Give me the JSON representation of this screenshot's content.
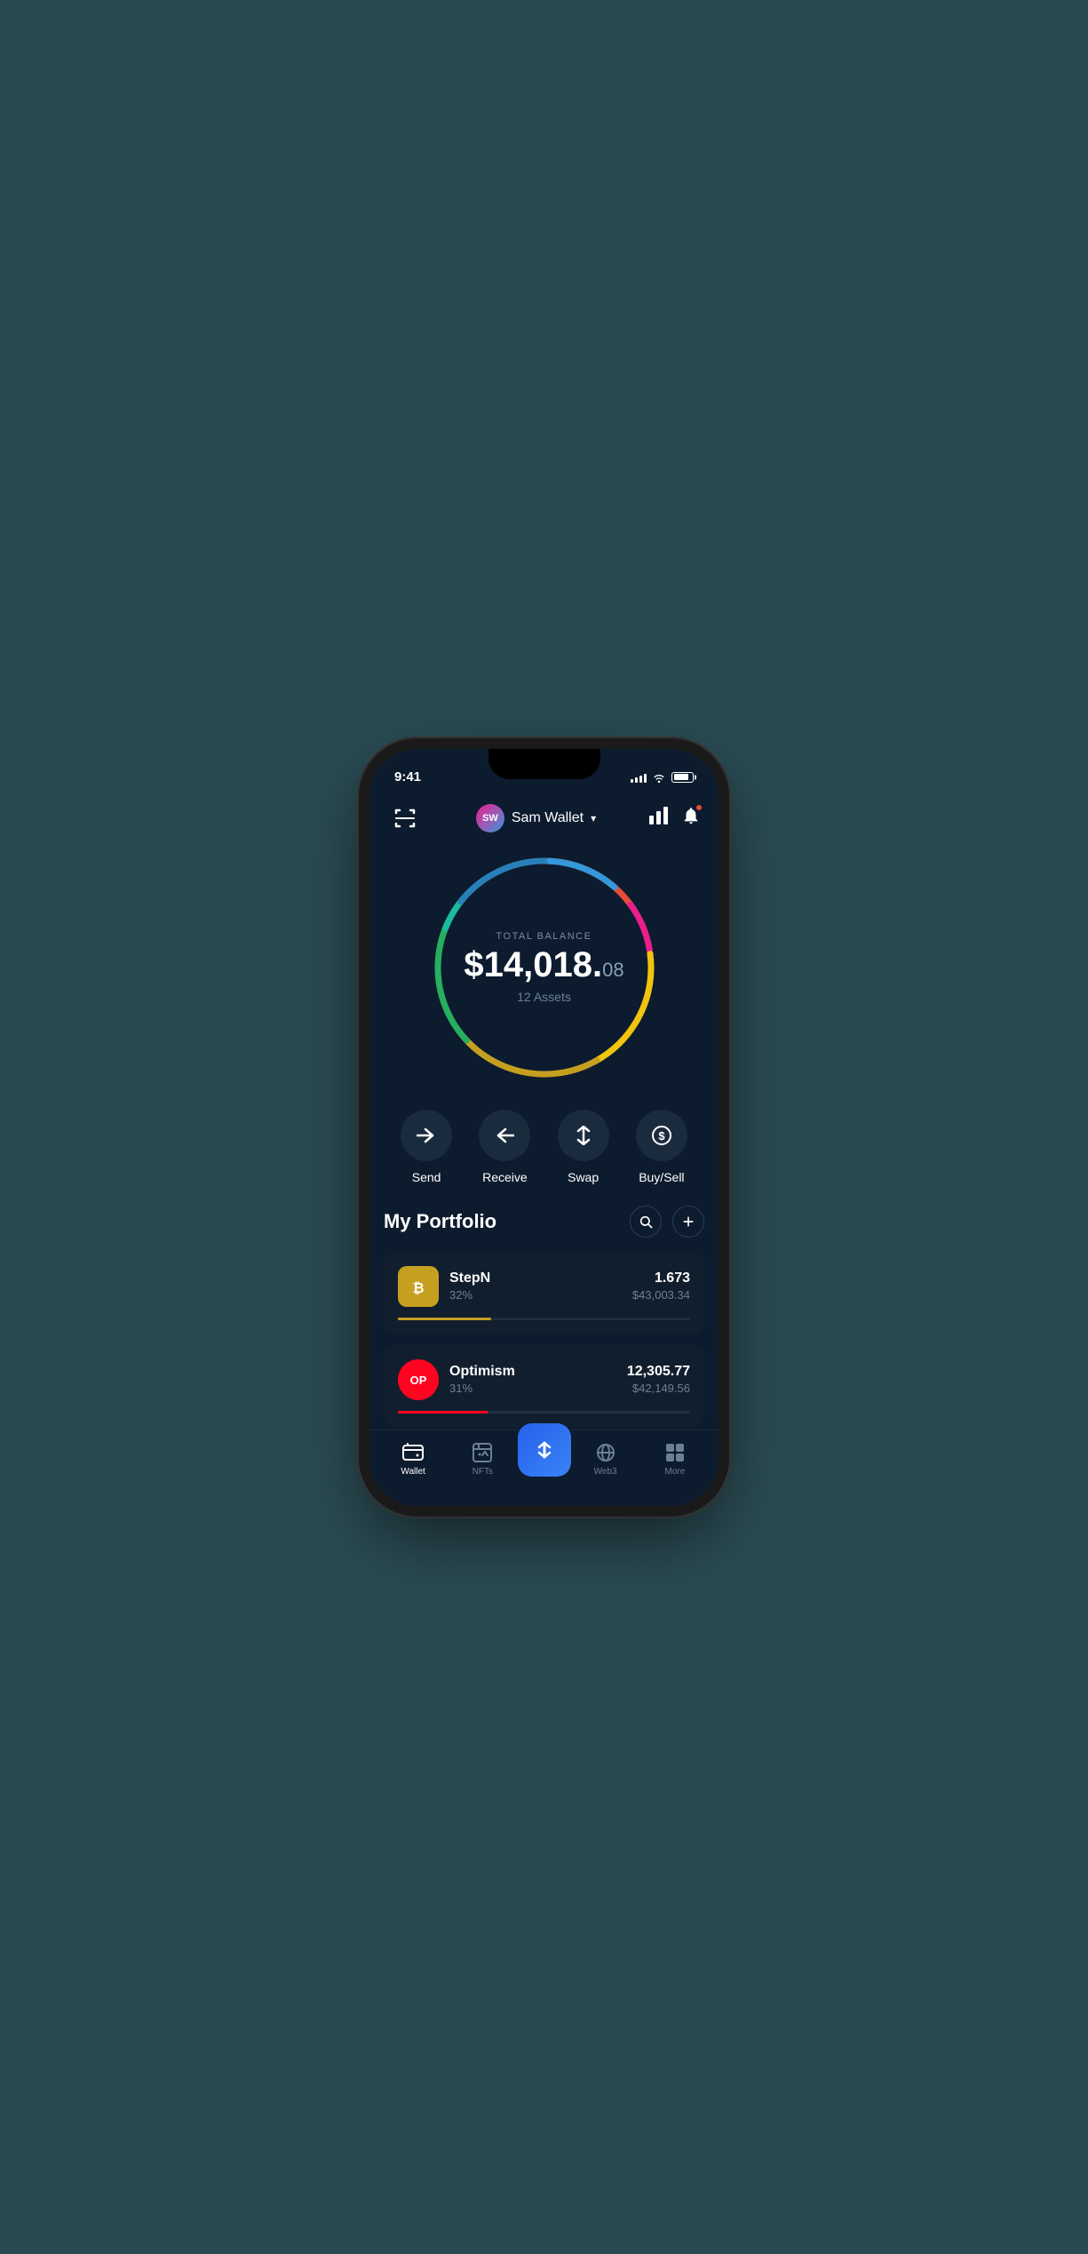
{
  "status": {
    "time": "9:41",
    "signal_bars": [
      3,
      5,
      7,
      9,
      11
    ],
    "battery_percent": 80
  },
  "header": {
    "scan_icon": "scan",
    "wallet_initials": "SW",
    "wallet_name": "Sam Wallet",
    "chevron": "▾",
    "chart_label": "chart-icon",
    "bell_label": "bell-icon"
  },
  "balance": {
    "label": "TOTAL BALANCE",
    "amount_main": "$14,018.",
    "amount_cents": "08",
    "assets_count": "12 Assets"
  },
  "actions": [
    {
      "id": "send",
      "label": "Send",
      "icon": "→"
    },
    {
      "id": "receive",
      "label": "Receive",
      "icon": "←"
    },
    {
      "id": "swap",
      "label": "Swap",
      "icon": "⇅"
    },
    {
      "id": "buysell",
      "label": "Buy/Sell",
      "icon": "$"
    }
  ],
  "portfolio": {
    "title": "My Portfolio",
    "search_label": "search",
    "add_label": "add"
  },
  "assets": [
    {
      "id": "stepn",
      "name": "StepN",
      "percent": "32%",
      "amount": "1.673",
      "usd": "$43,003.34",
      "progress": 32,
      "progress_color": "#c5a020",
      "icon_bg": "#c5a020",
      "icon_text": "₿"
    },
    {
      "id": "optimism",
      "name": "Optimism",
      "percent": "31%",
      "amount": "12,305.77",
      "usd": "$42,149.56",
      "progress": 31,
      "progress_color": "#ff0420",
      "icon_bg": "#ff0420",
      "icon_text": "OP"
    }
  ],
  "nav": {
    "items": [
      {
        "id": "wallet",
        "label": "Wallet",
        "active": true
      },
      {
        "id": "nfts",
        "label": "NFTs",
        "active": false
      },
      {
        "id": "center",
        "label": "",
        "active": false
      },
      {
        "id": "web3",
        "label": "Web3",
        "active": false
      },
      {
        "id": "more",
        "label": "More",
        "active": false
      }
    ]
  },
  "circle": {
    "segments": [
      {
        "color": "#e74c3c",
        "start": 0,
        "length": 55
      },
      {
        "color": "#e91e8c",
        "start": 55,
        "length": 30
      },
      {
        "color": "#f1c40f",
        "start": 85,
        "length": 70
      },
      {
        "color": "#c5a020",
        "start": 155,
        "length": 80
      },
      {
        "color": "#27ae60",
        "start": 235,
        "length": 70
      },
      {
        "color": "#16a085",
        "start": 305,
        "length": 20
      },
      {
        "color": "#1abc9c",
        "start": 325,
        "length": 10
      },
      {
        "color": "#2980b9",
        "start": 335,
        "length": 60
      },
      {
        "color": "#3498db",
        "start": 395,
        "length": 40
      }
    ]
  }
}
